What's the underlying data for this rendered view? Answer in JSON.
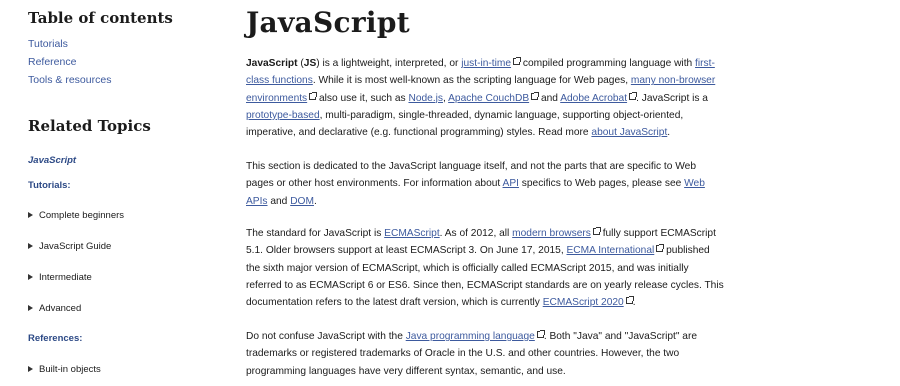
{
  "toc": {
    "title": "Table of contents",
    "links": [
      "Tutorials",
      "Reference",
      "Tools & resources"
    ]
  },
  "related": {
    "title": "Related Topics",
    "current": "JavaScript",
    "tutorials_heading": "Tutorials:",
    "tutorials": [
      "Complete beginners",
      "JavaScript Guide",
      "Intermediate",
      "Advanced"
    ],
    "references_heading": "References:",
    "references": [
      "Built-in objects"
    ]
  },
  "main": {
    "title": "JavaScript",
    "p1": {
      "b1": "JavaScript",
      "t1": " (",
      "b2": "JS",
      "t2": ") is a lightweight, interpreted, or ",
      "l1": "just-in-time",
      "t3": " compiled programming language with ",
      "l2": "first-class functions",
      "t4": ". While it is most well-known as the scripting language for Web pages, ",
      "l3": "many non-browser environments",
      "t5": " also use it, such as ",
      "l4": "Node.js",
      "t6": ", ",
      "l5": "Apache CouchDB",
      "t7": " and ",
      "l6": "Adobe Acrobat",
      "t8": ". JavaScript is a ",
      "l7": "prototype-based",
      "t9": ", multi-paradigm, single-threaded, dynamic language, supporting object-oriented, imperative, and declarative (e.g. functional programming) styles. Read more ",
      "l8": "about JavaScript",
      "t10": "."
    },
    "p2": {
      "t1": "This section is dedicated to the JavaScript language itself, and not the parts that are specific to Web pages or other host environments. For information about ",
      "l1": "API",
      "t2": " specifics to Web pages, please see ",
      "l2": "Web APIs",
      "t3": " and ",
      "l3": "DOM",
      "t4": "."
    },
    "p3": {
      "t1": "The standard for JavaScript is ",
      "l1": "ECMAScript",
      "t2": ". As of 2012, all ",
      "l2": "modern browsers",
      "t3": " fully support ECMAScript 5.1. Older browsers support at least ECMAScript 3. On June 17, 2015, ",
      "l3": "ECMA International",
      "t4": " published the sixth major version of ECMAScript, which is officially called ECMAScript 2015, and was initially referred to as ECMAScript 6 or ES6. Since then, ECMAScript standards are on yearly release cycles. This documentation refers to the latest draft version, which is currently ",
      "l4": "ECMAScript 2020",
      "t5": "."
    },
    "p4": {
      "t1": "Do not confuse JavaScript with the ",
      "l1": "Java programming language",
      "t2": ". Both \"Java\" and \"JavaScript\" are trademarks or registered trademarks of Oracle in the U.S. and other countries. However, the two programming languages have very different syntax, semantic, and use."
    }
  }
}
